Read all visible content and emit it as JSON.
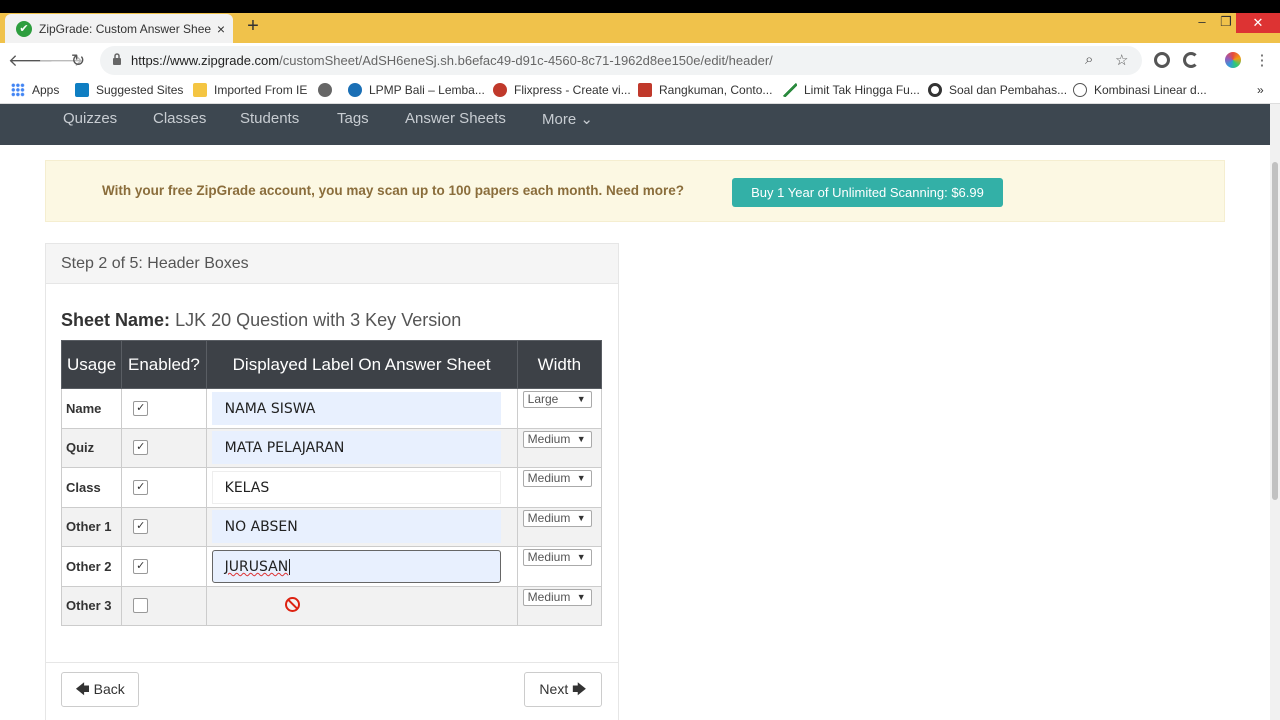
{
  "browser": {
    "tab_title": "ZipGrade: Custom Answer Sheets",
    "tab_close": "×",
    "new_tab": "+",
    "url_domain": "https://www.zipgrade.com",
    "url_path": "/customSheet/AdSH6eneSj.sh.b6efac49-d91c-4560-8c71-1962d8ee150e/edit/header/",
    "window_controls": [
      "–",
      "❐",
      "✕"
    ]
  },
  "bookmarks": [
    {
      "label": "Apps",
      "icon": "apps-icon",
      "color": "#4285f4"
    },
    {
      "label": "Suggested Sites",
      "icon": "bing-icon",
      "color": "#0f7ec2"
    },
    {
      "label": "Imported From IE",
      "icon": "folder-icon",
      "color": "#f4c542"
    },
    {
      "label": "",
      "icon": "globe-icon",
      "color": "#666666"
    },
    {
      "label": "LPMP Bali – Lemba...",
      "icon": "lpmp-icon",
      "color": "#1a6fb5"
    },
    {
      "label": "Flixpress - Create vi...",
      "icon": "flixpress-icon",
      "color": "#c0392b"
    },
    {
      "label": "Rangkuman, Conto...",
      "icon": "question-icon",
      "color": "#c0392b"
    },
    {
      "label": "Limit Tak Hingga Fu...",
      "icon": "chart-icon",
      "color": "#2b8a3e"
    },
    {
      "label": "Soal dan Pembahas...",
      "icon": "circle-icon",
      "color": "#333333"
    },
    {
      "label": "Kombinasi Linear d...",
      "icon": "k-icon",
      "color": "#555555"
    }
  ],
  "nav": {
    "items": [
      "Quizzes",
      "Classes",
      "Students",
      "Tags",
      "Answer Sheets",
      "More ⌄"
    ]
  },
  "promo": {
    "text": "With your free ZipGrade account, you may scan up to 100 papers each month. Need more?",
    "button": "Buy 1 Year of Unlimited Scanning: $6.99"
  },
  "panel": {
    "title": "Step 2 of 5: Header Boxes",
    "sheet_name_label": "Sheet Name:",
    "sheet_name_value": "LJK 20 Question with 3 Key Version"
  },
  "table": {
    "headers": [
      "Usage",
      "Enabled?",
      "Displayed Label On Answer Sheet",
      "Width"
    ],
    "rows": [
      {
        "usage": "Name",
        "enabled": "✓",
        "label": "NAMA SISWA",
        "width": "Large"
      },
      {
        "usage": "Quiz",
        "enabled": "✓",
        "label": "MATA PELAJARAN",
        "width": "Medium"
      },
      {
        "usage": "Class",
        "enabled": "✓",
        "label": "KELAS",
        "width": "Medium"
      },
      {
        "usage": "Other 1",
        "enabled": "✓",
        "label": "NO ABSEN",
        "width": "Medium"
      },
      {
        "usage": "Other 2",
        "enabled": "✓",
        "label": "JURUSAN",
        "width": "Medium"
      },
      {
        "usage": "Other 3",
        "enabled": "",
        "label": "",
        "width": "Medium"
      }
    ]
  },
  "buttons": {
    "back": "🡄 Back",
    "next": "Next 🡆"
  }
}
